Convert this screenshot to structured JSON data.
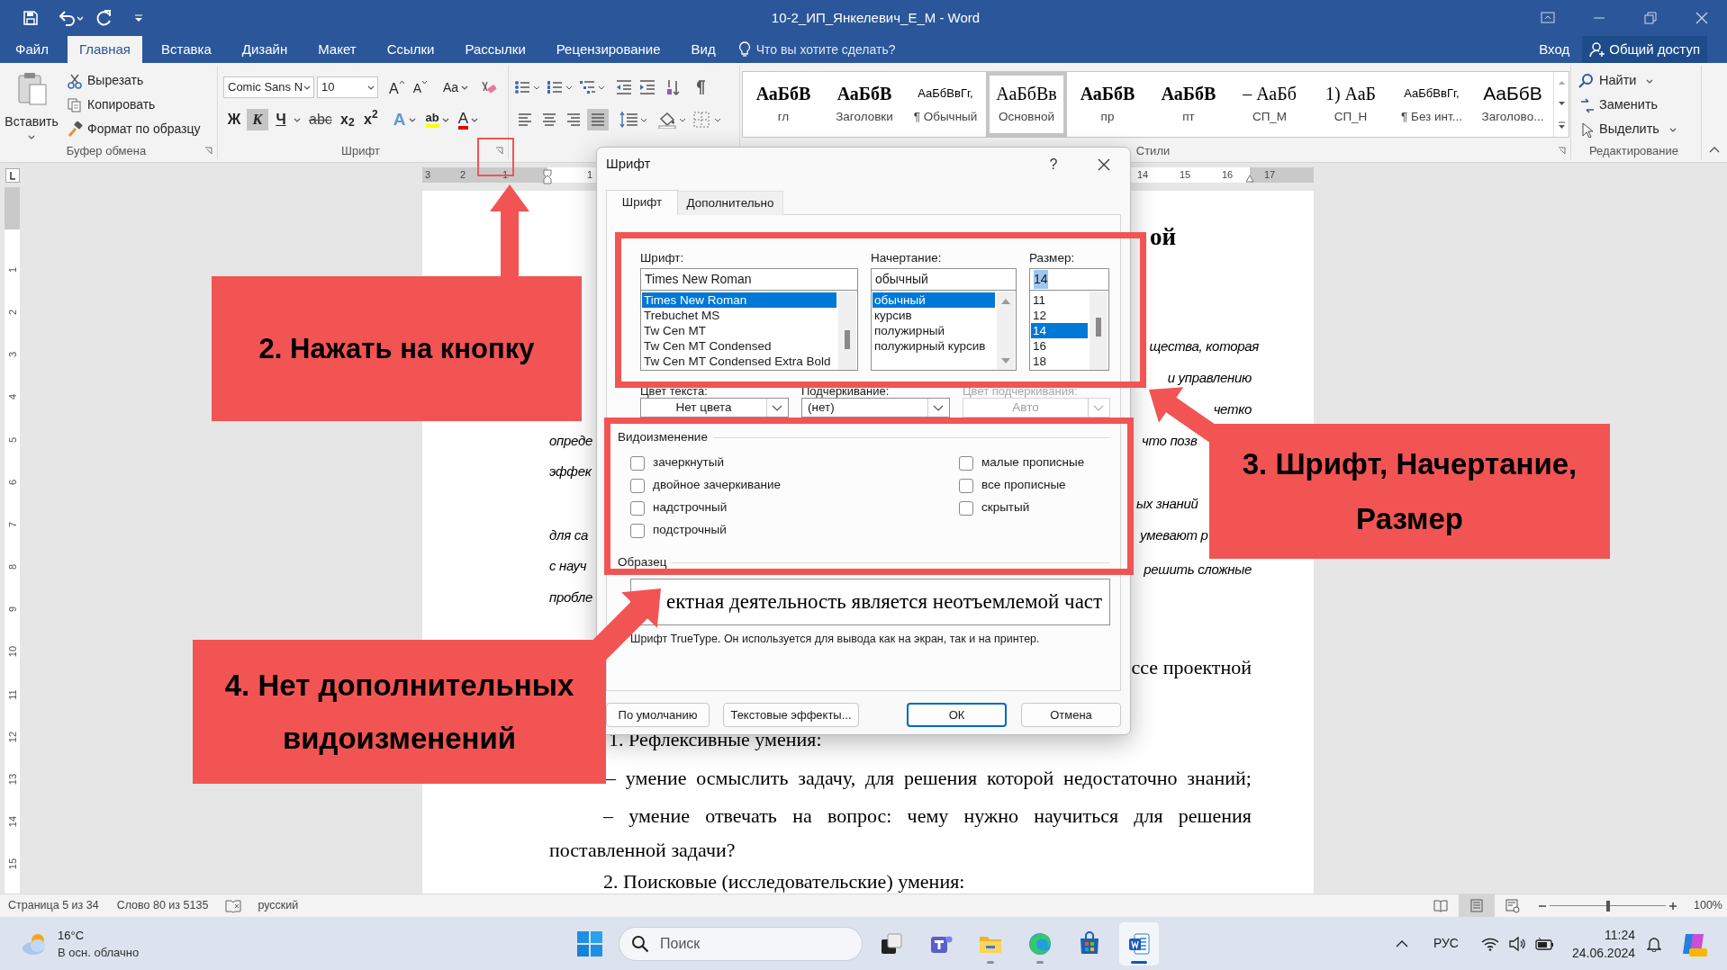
{
  "window": {
    "title": "10-2_ИП_Янкелевич_Е_М - Word"
  },
  "ribbon_tabs": [
    {
      "label": "Файл",
      "selected": false
    },
    {
      "label": "Главная",
      "selected": true
    },
    {
      "label": "Вставка",
      "selected": false
    },
    {
      "label": "Дизайн",
      "selected": false
    },
    {
      "label": "Макет",
      "selected": false
    },
    {
      "label": "Ссылки",
      "selected": false
    },
    {
      "label": "Рассылки",
      "selected": false
    },
    {
      "label": "Рецензирование",
      "selected": false
    },
    {
      "label": "Вид",
      "selected": false
    }
  ],
  "tell_me": {
    "placeholder": "Что вы хотите сделать?"
  },
  "account": {
    "sign_in": "Вход",
    "share": "Общий доступ"
  },
  "clipboard_group": {
    "paste": "Вставить",
    "items": [
      {
        "kind": "cut",
        "label": "Вырезать"
      },
      {
        "kind": "copy",
        "label": "Копировать"
      },
      {
        "kind": "format_painter",
        "label": "Формат по образцу"
      }
    ],
    "label": "Буфер обмена"
  },
  "font_group": {
    "font_name": "Comic Sans N",
    "font_size": "10",
    "grow": "A",
    "shrink": "A",
    "change_case": "Aa",
    "format_buttons": [
      {
        "label": "Ж",
        "kind": "bold",
        "selected": false
      },
      {
        "label": "К",
        "kind": "italic",
        "selected": true
      },
      {
        "label": "Ч",
        "kind": "underline",
        "selected": false
      },
      {
        "label": "abc",
        "kind": "strike",
        "selected": false
      },
      {
        "label": "x$_{2}$",
        "kind": "sub",
        "selected": false
      },
      {
        "label": "x$^{2}$",
        "kind": "sup",
        "selected": false
      }
    ],
    "effects": "A",
    "highlight": "ab",
    "font_color": "A",
    "label": "Шрифт"
  },
  "paragraph_group": {
    "alignment": [
      {
        "kind": "left",
        "selected": false
      },
      {
        "kind": "center",
        "selected": false
      },
      {
        "kind": "right",
        "selected": false
      },
      {
        "kind": "justify",
        "selected": true
      }
    ]
  },
  "styles_group": {
    "items": [
      {
        "preview": "АаБбВ",
        "name": "гл",
        "kind": "serif_bold",
        "selected": false
      },
      {
        "preview": "АаБбВ",
        "name": "Заголовки",
        "kind": "serif_bold",
        "selected": false
      },
      {
        "preview": "АаБбВвГг,",
        "name": "¶ Обычный",
        "kind": "sans",
        "selected": false
      },
      {
        "preview": "АаБбВв",
        "name": "Основной",
        "kind": "serif",
        "selected": true
      },
      {
        "preview": "АаБбВ",
        "name": "пр",
        "kind": "serif_bold",
        "selected": false
      },
      {
        "preview": "АаБбВ",
        "name": "пт",
        "kind": "serif_bold",
        "selected": false
      },
      {
        "preview": "– АаБб",
        "name": "СП_М",
        "kind": "serif",
        "selected": false
      },
      {
        "preview": "1) АаБ",
        "name": "СП_Н",
        "kind": "serif",
        "selected": false
      },
      {
        "preview": "АаБбВвГг,",
        "name": "¶ Без инт...",
        "kind": "sans",
        "selected": false
      },
      {
        "preview": "АаБбВ",
        "name": "Заголово...",
        "kind": "heading_blue",
        "selected": false
      }
    ],
    "label": "Стили"
  },
  "editing_group": {
    "items": [
      {
        "kind": "find",
        "label": "Найти"
      },
      {
        "kind": "replace",
        "label": "Заменить"
      },
      {
        "kind": "select",
        "label": "Выделить"
      }
    ],
    "label": "Редактирование"
  },
  "ruler": {
    "numbers": [
      "3",
      "2",
      "1",
      "1",
      "14",
      "15",
      "16",
      "17"
    ],
    "vertical_numbers": [
      "1",
      "2",
      "3",
      "4",
      "5",
      "6",
      "7",
      "8",
      "9",
      "10",
      "11",
      "12",
      "13",
      "14",
      "15"
    ]
  },
  "document": {
    "fragments": [
      {
        "text": "ой",
        "kind": "heading"
      },
      {
        "text": "щества, которая",
        "kind": "italic"
      },
      {
        "text": "и управлению",
        "kind": "italic"
      },
      {
        "text": "четко",
        "kind": "italic"
      },
      {
        "text": "опреде",
        "kind": "italic"
      },
      {
        "text": "что позв",
        "kind": "italic"
      },
      {
        "text": "эффек",
        "kind": "italic"
      },
      {
        "text": "ых знаний",
        "kind": "italic"
      },
      {
        "text": "для са",
        "kind": "italic"
      },
      {
        "text": "умевают р",
        "kind": "italic"
      },
      {
        "text": "с науч",
        "kind": "italic"
      },
      {
        "text": "решить сложные",
        "kind": "italic"
      },
      {
        "text": "пробле",
        "kind": "italic"
      },
      {
        "text": "ссе проектной",
        "kind": "serif"
      },
      {
        "text": "1. Рефлексивные умения:",
        "kind": "serif"
      },
      {
        "text": "– умение осмыслить задачу, для решения которой недостаточно знаний;",
        "kind": "serif"
      },
      {
        "text": "– умение отвечать на вопрос: чему нужно научиться для решения",
        "kind": "serif"
      },
      {
        "text": "поставленной задачи?",
        "kind": "serif"
      },
      {
        "text": "2. Поисковые (исследовательские) умения:",
        "kind": "serif"
      }
    ]
  },
  "dialog": {
    "title": "Шрифт",
    "help": "?",
    "tabs": [
      {
        "label": "Шрифт",
        "selected": true
      },
      {
        "label": "Дополнительно",
        "selected": false
      }
    ],
    "font": {
      "label": "Шрифт:",
      "value": "Times New Roman",
      "options": [
        {
          "label": "Times New Roman",
          "selected": true
        },
        {
          "label": "Trebuchet MS",
          "selected": false
        },
        {
          "label": "Tw Cen MT",
          "selected": false
        },
        {
          "label": "Tw Cen MT Condensed",
          "selected": false
        },
        {
          "label": "Tw Cen MT Condensed Extra Bold",
          "selected": false
        }
      ]
    },
    "style": {
      "label": "Начертание:",
      "value": "обычный",
      "options": [
        {
          "label": "обычный",
          "selected": true
        },
        {
          "label": "курсив",
          "selected": false
        },
        {
          "label": "полужирный",
          "selected": false
        },
        {
          "label": "полужирный курсив",
          "selected": false
        }
      ]
    },
    "size": {
      "label": "Размер:",
      "value": "14",
      "value_highlighted": true,
      "options": [
        {
          "label": "11",
          "selected": false
        },
        {
          "label": "12",
          "selected": false
        },
        {
          "label": "14",
          "selected": true
        },
        {
          "label": "16",
          "selected": false
        },
        {
          "label": "18",
          "selected": false
        }
      ]
    },
    "dropdowns": [
      {
        "label": "Цвет текста:",
        "value": "Нет цвета",
        "disabled": false
      },
      {
        "label": "Подчеркивание:",
        "value": "(нет)",
        "disabled": false
      },
      {
        "label": "Цвет подчеркивания:",
        "value": "Авто",
        "disabled": true
      }
    ],
    "effects": {
      "label": "Видоизменение",
      "options": [
        {
          "label": "зачеркнутый",
          "checked": false
        },
        {
          "label": "двойное зачеркивание",
          "checked": false
        },
        {
          "label": "надстрочный",
          "checked": false
        },
        {
          "label": "подстрочный",
          "checked": false
        },
        {
          "label": "малые прописные",
          "checked": false
        },
        {
          "label": "все прописные",
          "checked": false
        },
        {
          "label": "скрытый",
          "checked": false
        }
      ]
    },
    "preview": {
      "label": "Образец",
      "text": "ектная деятельность является неотъемлемой част",
      "note": "Шрифт TrueType. Он используется для вывода как на экран, так и на принтер."
    },
    "buttons": [
      {
        "label": "По умолчанию",
        "default": false
      },
      {
        "label": "Текстовые эффекты...",
        "default": false
      },
      {
        "label": "ОК",
        "default": true
      },
      {
        "label": "Отмена",
        "default": false
      }
    ]
  },
  "callouts": [
    {
      "lines": [
        "2. Нажать на кнопку"
      ]
    },
    {
      "lines": [
        "3. Шрифт, Начертание,",
        "Размер"
      ]
    },
    {
      "lines": [
        "4. Нет дополнительных",
        "видоизменений"
      ]
    }
  ],
  "status_bar": {
    "page": "Страница 5 из 34",
    "words": "Слово 80 из 5135",
    "language": "русский",
    "views": [
      {
        "kind": "read",
        "selected": false
      },
      {
        "kind": "print",
        "selected": true
      },
      {
        "kind": "web",
        "selected": false
      }
    ],
    "zoom_slider": {
      "level": 0.5
    },
    "zoom": "100%"
  },
  "taskbar": {
    "weather": {
      "temperature": "16°C",
      "condition": "В осн. облачно"
    },
    "search": {
      "placeholder": "Поиск"
    },
    "apps": [
      {
        "kind": "task_view",
        "running": false,
        "selected": false
      },
      {
        "kind": "teams",
        "running": false,
        "selected": false
      },
      {
        "kind": "explorer",
        "running": true,
        "selected": false
      },
      {
        "kind": "edge",
        "running": true,
        "selected": false
      },
      {
        "kind": "store",
        "running": false,
        "selected": false
      },
      {
        "kind": "word",
        "running": true,
        "selected": true
      }
    ],
    "language": "РУС",
    "time": "11:24",
    "date": "24.06.2024"
  }
}
